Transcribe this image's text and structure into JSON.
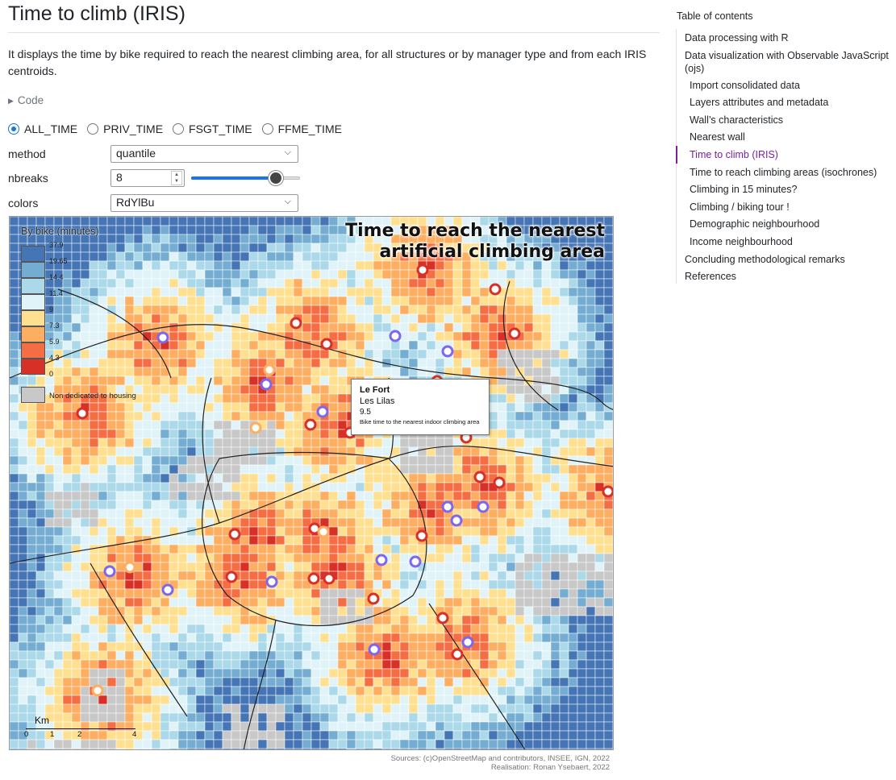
{
  "page": {
    "title": "Time to climb (IRIS)",
    "intro": "It displays the time by bike required to reach the nearest climbing area, for all structures or by manager type and from each IRIS centroids.",
    "code_label": "Code"
  },
  "radios": [
    {
      "label": "ALL_TIME",
      "checked": true
    },
    {
      "label": "PRIV_TIME",
      "checked": false
    },
    {
      "label": "FSGT_TIME",
      "checked": false
    },
    {
      "label": "FFME_TIME",
      "checked": false
    }
  ],
  "controls": {
    "method_label": "method",
    "method_value": "quantile",
    "nbreaks_label": "nbreaks",
    "nbreaks_value": "8",
    "nbreaks_slider_fraction": 0.78,
    "colors_label": "colors",
    "colors_value": "RdYlBu"
  },
  "map": {
    "title_line1": "Time to reach the nearest",
    "title_line2": "artificial climbing area",
    "legend_title": "By bike (minutes)",
    "legend_colors": [
      "#4575b4",
      "#74add1",
      "#abd9e9",
      "#e0f3f8",
      "#fee090",
      "#fdae61",
      "#f46d43",
      "#d73027"
    ],
    "legend_ticks": [
      "37.9",
      "19.65",
      "14.4",
      "11.4",
      "9",
      "7.3",
      "5.9",
      "4.3",
      "0"
    ],
    "non_dedicated_label": "Non dedicated to housing",
    "non_dedicated_color": "#c8c8c8",
    "scale_unit": "Km",
    "scale_labels": [
      "0",
      "1",
      "2",
      "4"
    ],
    "tooltip": {
      "name": "Le Fort",
      "city": "Les Lilas",
      "value": "9.5",
      "description": "Bike time to the nearest indoor climbing area"
    },
    "credits_line1": "Sources: (c)OpenStreetMap and contributors, INSEE, IGN, 2022",
    "credits_line2": "Realisation: Ronan Ysebaert, 2022"
  },
  "toc": {
    "heading": "Table of contents",
    "items": [
      {
        "label": "Data processing with R",
        "level": 1
      },
      {
        "label": "Data visualization with Observable JavaScript (ojs)",
        "level": 1
      },
      {
        "label": "Import consolidated data",
        "level": 2
      },
      {
        "label": "Layers attributes and metadata",
        "level": 2
      },
      {
        "label": "Wall’s characteristics",
        "level": 2
      },
      {
        "label": "Nearest wall",
        "level": 2
      },
      {
        "label": "Time to climb (IRIS)",
        "level": 2,
        "active": true
      },
      {
        "label": "Time to reach climbing areas (isochrones)",
        "level": 2
      },
      {
        "label": "Climbing in 15 minutes?",
        "level": 2
      },
      {
        "label": "Climbing / biking tour !",
        "level": 2
      },
      {
        "label": "Demographic neighbourhood",
        "level": 2
      },
      {
        "label": "Income neighbourhood",
        "level": 2
      },
      {
        "label": "Concluding methodological remarks",
        "level": 1
      },
      {
        "label": "References",
        "level": 1
      }
    ]
  }
}
